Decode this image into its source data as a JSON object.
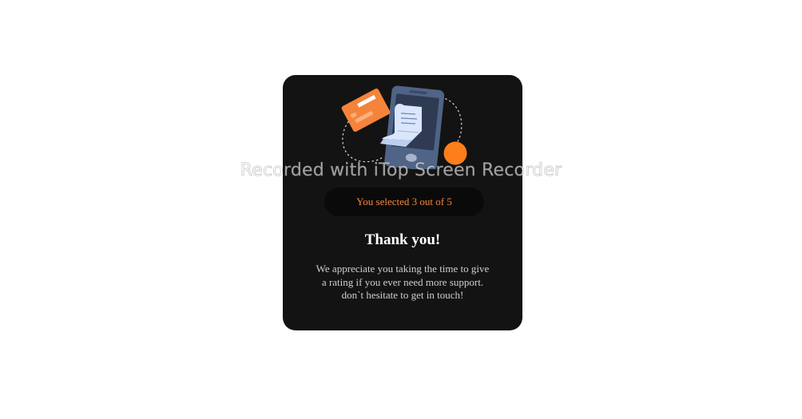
{
  "rating": {
    "selected": 3,
    "max": 5,
    "summary_text": "You selected 3 out of 5"
  },
  "heading": "Thank you!",
  "message_lines": [
    "We appreciate you taking the time to give",
    "a rating if you ever need more support.",
    "don`t hesitate to get in touch!"
  ],
  "watermark": "Recorded with iTop Screen Recorder",
  "illustration": {
    "icon": "payment-receipt-phone-icon"
  },
  "colors": {
    "accent": "#f5843a",
    "card_background": "#131313",
    "pill_background": "#0a0a0a",
    "phone": "#4f6486",
    "receipt": "#d9e6fb"
  }
}
